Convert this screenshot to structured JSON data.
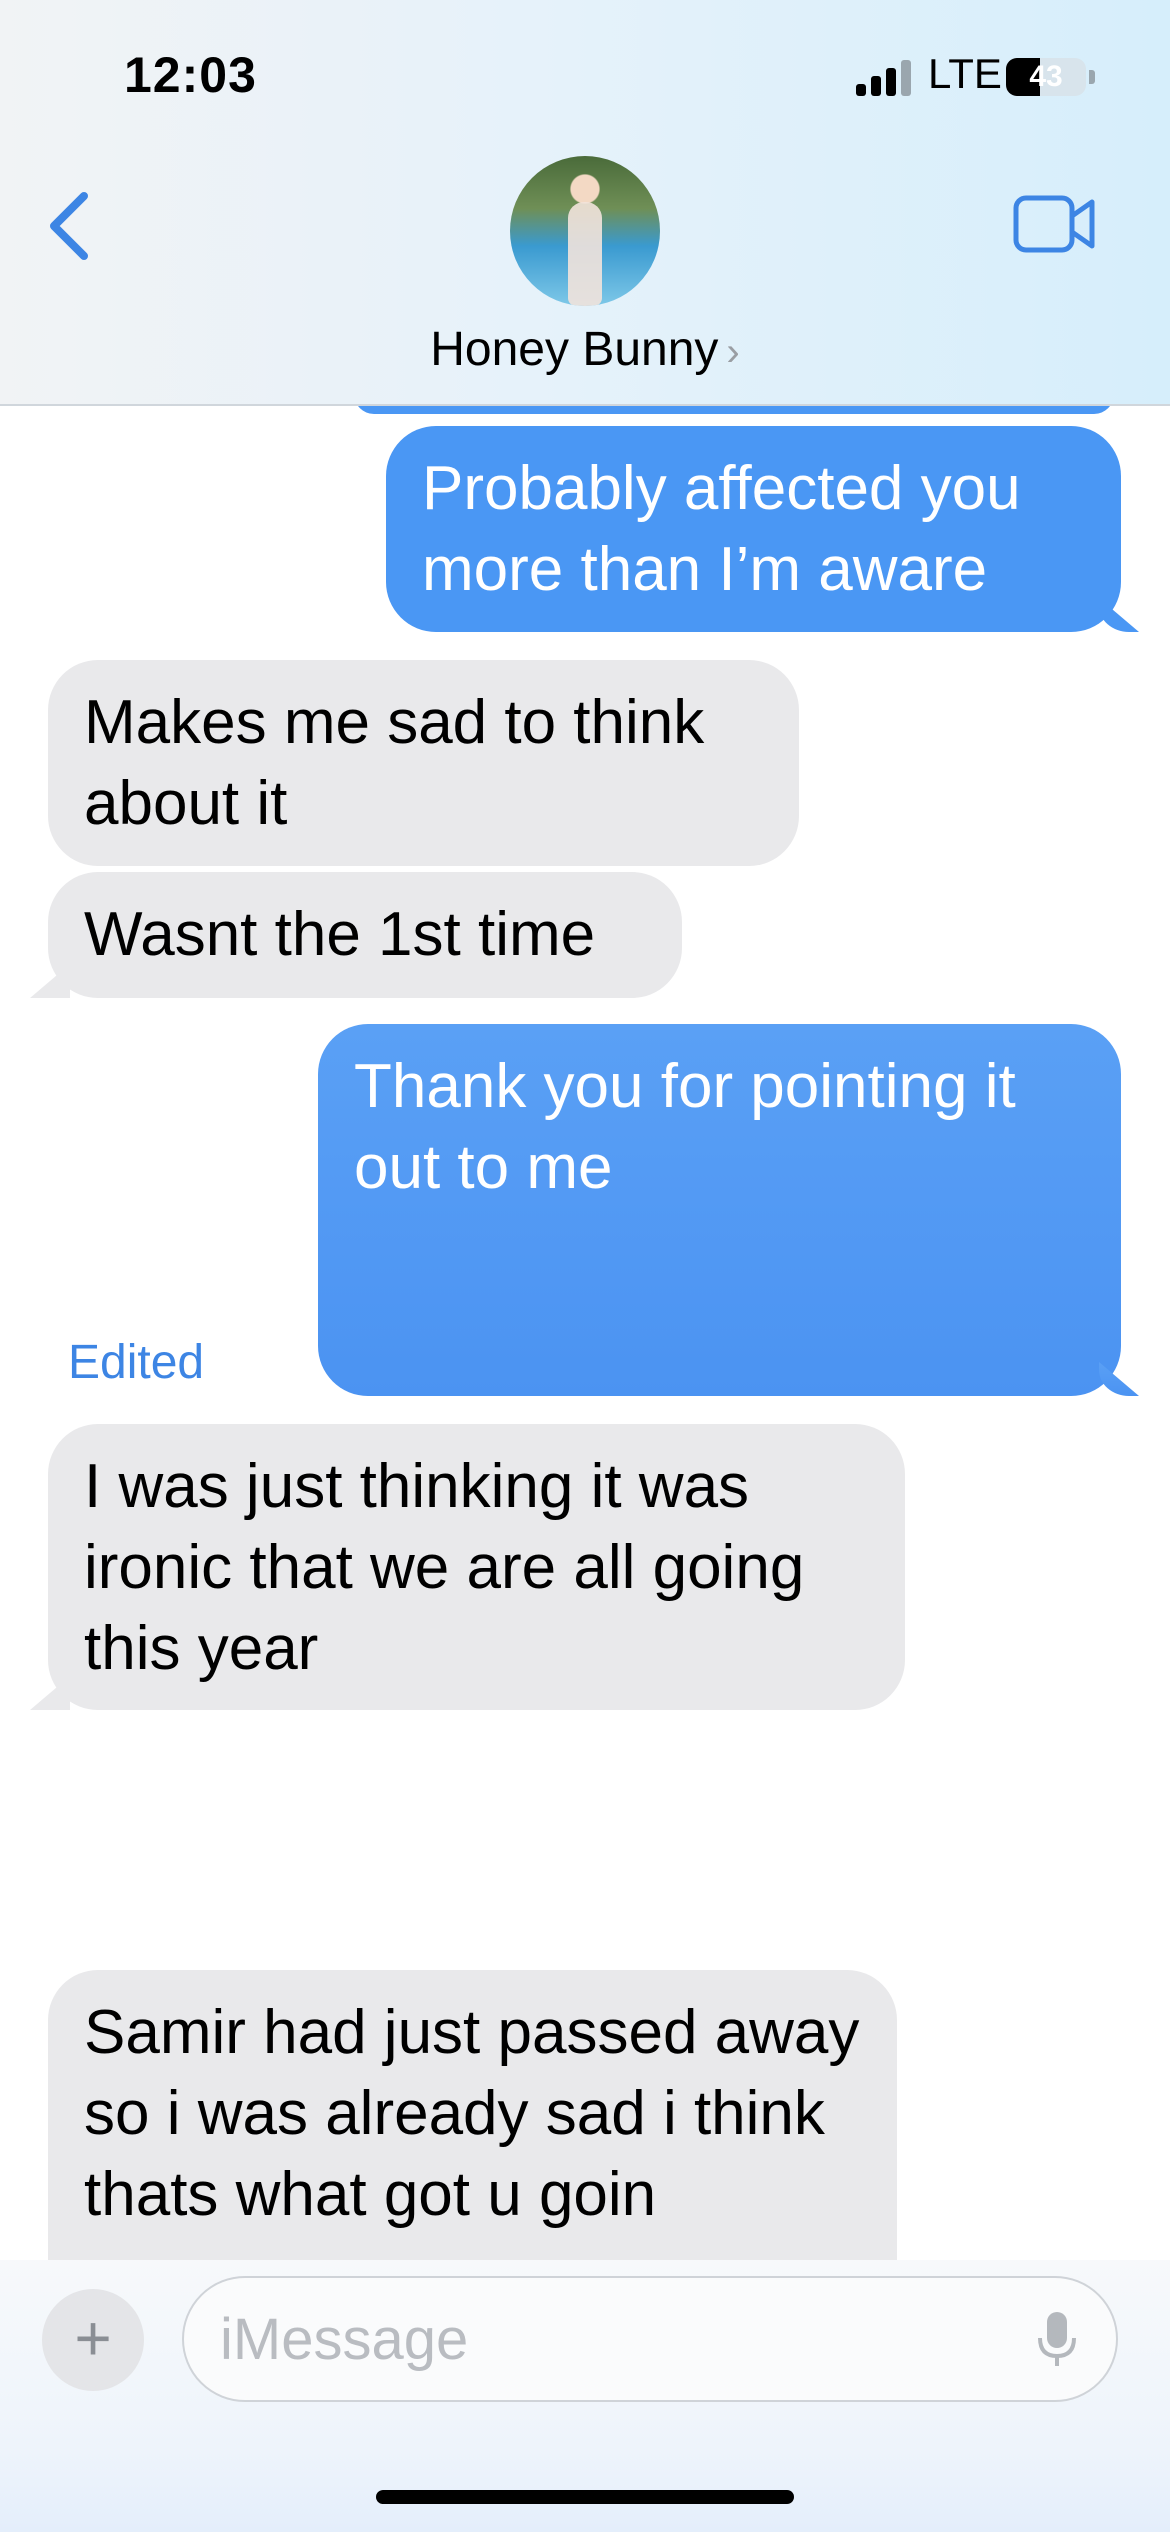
{
  "status_bar": {
    "time": "12:03",
    "network": "LTE",
    "battery": "43",
    "battery_level": 0.43
  },
  "header": {
    "contact_name": "Honey Bunny",
    "chevron": "›"
  },
  "icons": {
    "back": "chevron-left-icon",
    "video": "video-camera-icon",
    "mic": "microphone-icon",
    "add": "plus-icon"
  },
  "colors": {
    "accent": "#3d85e4",
    "sent_bubble": "#4a97f4",
    "received_bubble": "#e9e9eb"
  },
  "messages": [
    {
      "direction": "sent",
      "text": "Probably affected you more than I’m aware"
    },
    {
      "direction": "received",
      "text": "Makes me sad to think about it"
    },
    {
      "direction": "received",
      "text": "Wasnt the 1st time"
    },
    {
      "direction": "sent",
      "text": "Thank you for pointing it out to me"
    },
    {
      "direction": "received",
      "text": "I was just thinking it was ironic that we are all going this year"
    },
    {
      "direction": "received",
      "text": "Samir had just passed away so i was already sad i think thats what got u goin"
    }
  ],
  "edited_label": "Edited",
  "composer": {
    "plus": "+",
    "placeholder": "iMessage"
  }
}
